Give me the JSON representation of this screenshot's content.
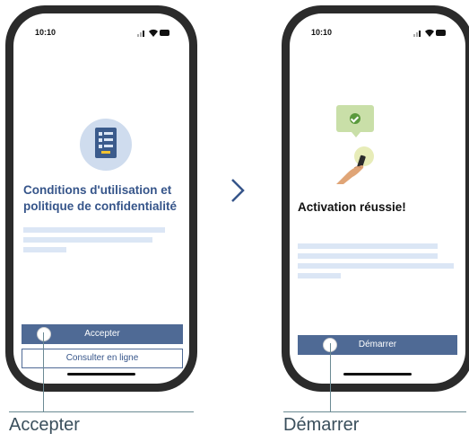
{
  "left_phone": {
    "status_time": "10:10",
    "title": "Conditions d'utilisation et politique de confidentialité",
    "accept_button": "Accepter",
    "online_button": "Consulter en ligne"
  },
  "right_phone": {
    "status_time": "10:10",
    "title": "Activation réussie!",
    "start_button": "Démarrer"
  },
  "captions": {
    "left": "Accepter",
    "right": "Démarrer"
  },
  "icons": {
    "document": "document-icon",
    "check": "check-icon",
    "hand": "hand-phone-icon",
    "next": "chevron-right-icon"
  },
  "colors": {
    "accent": "#4f6a95",
    "title_blue": "#36558a",
    "placeholder": "#dbe6f5",
    "caption_line": "#6b8a93"
  }
}
